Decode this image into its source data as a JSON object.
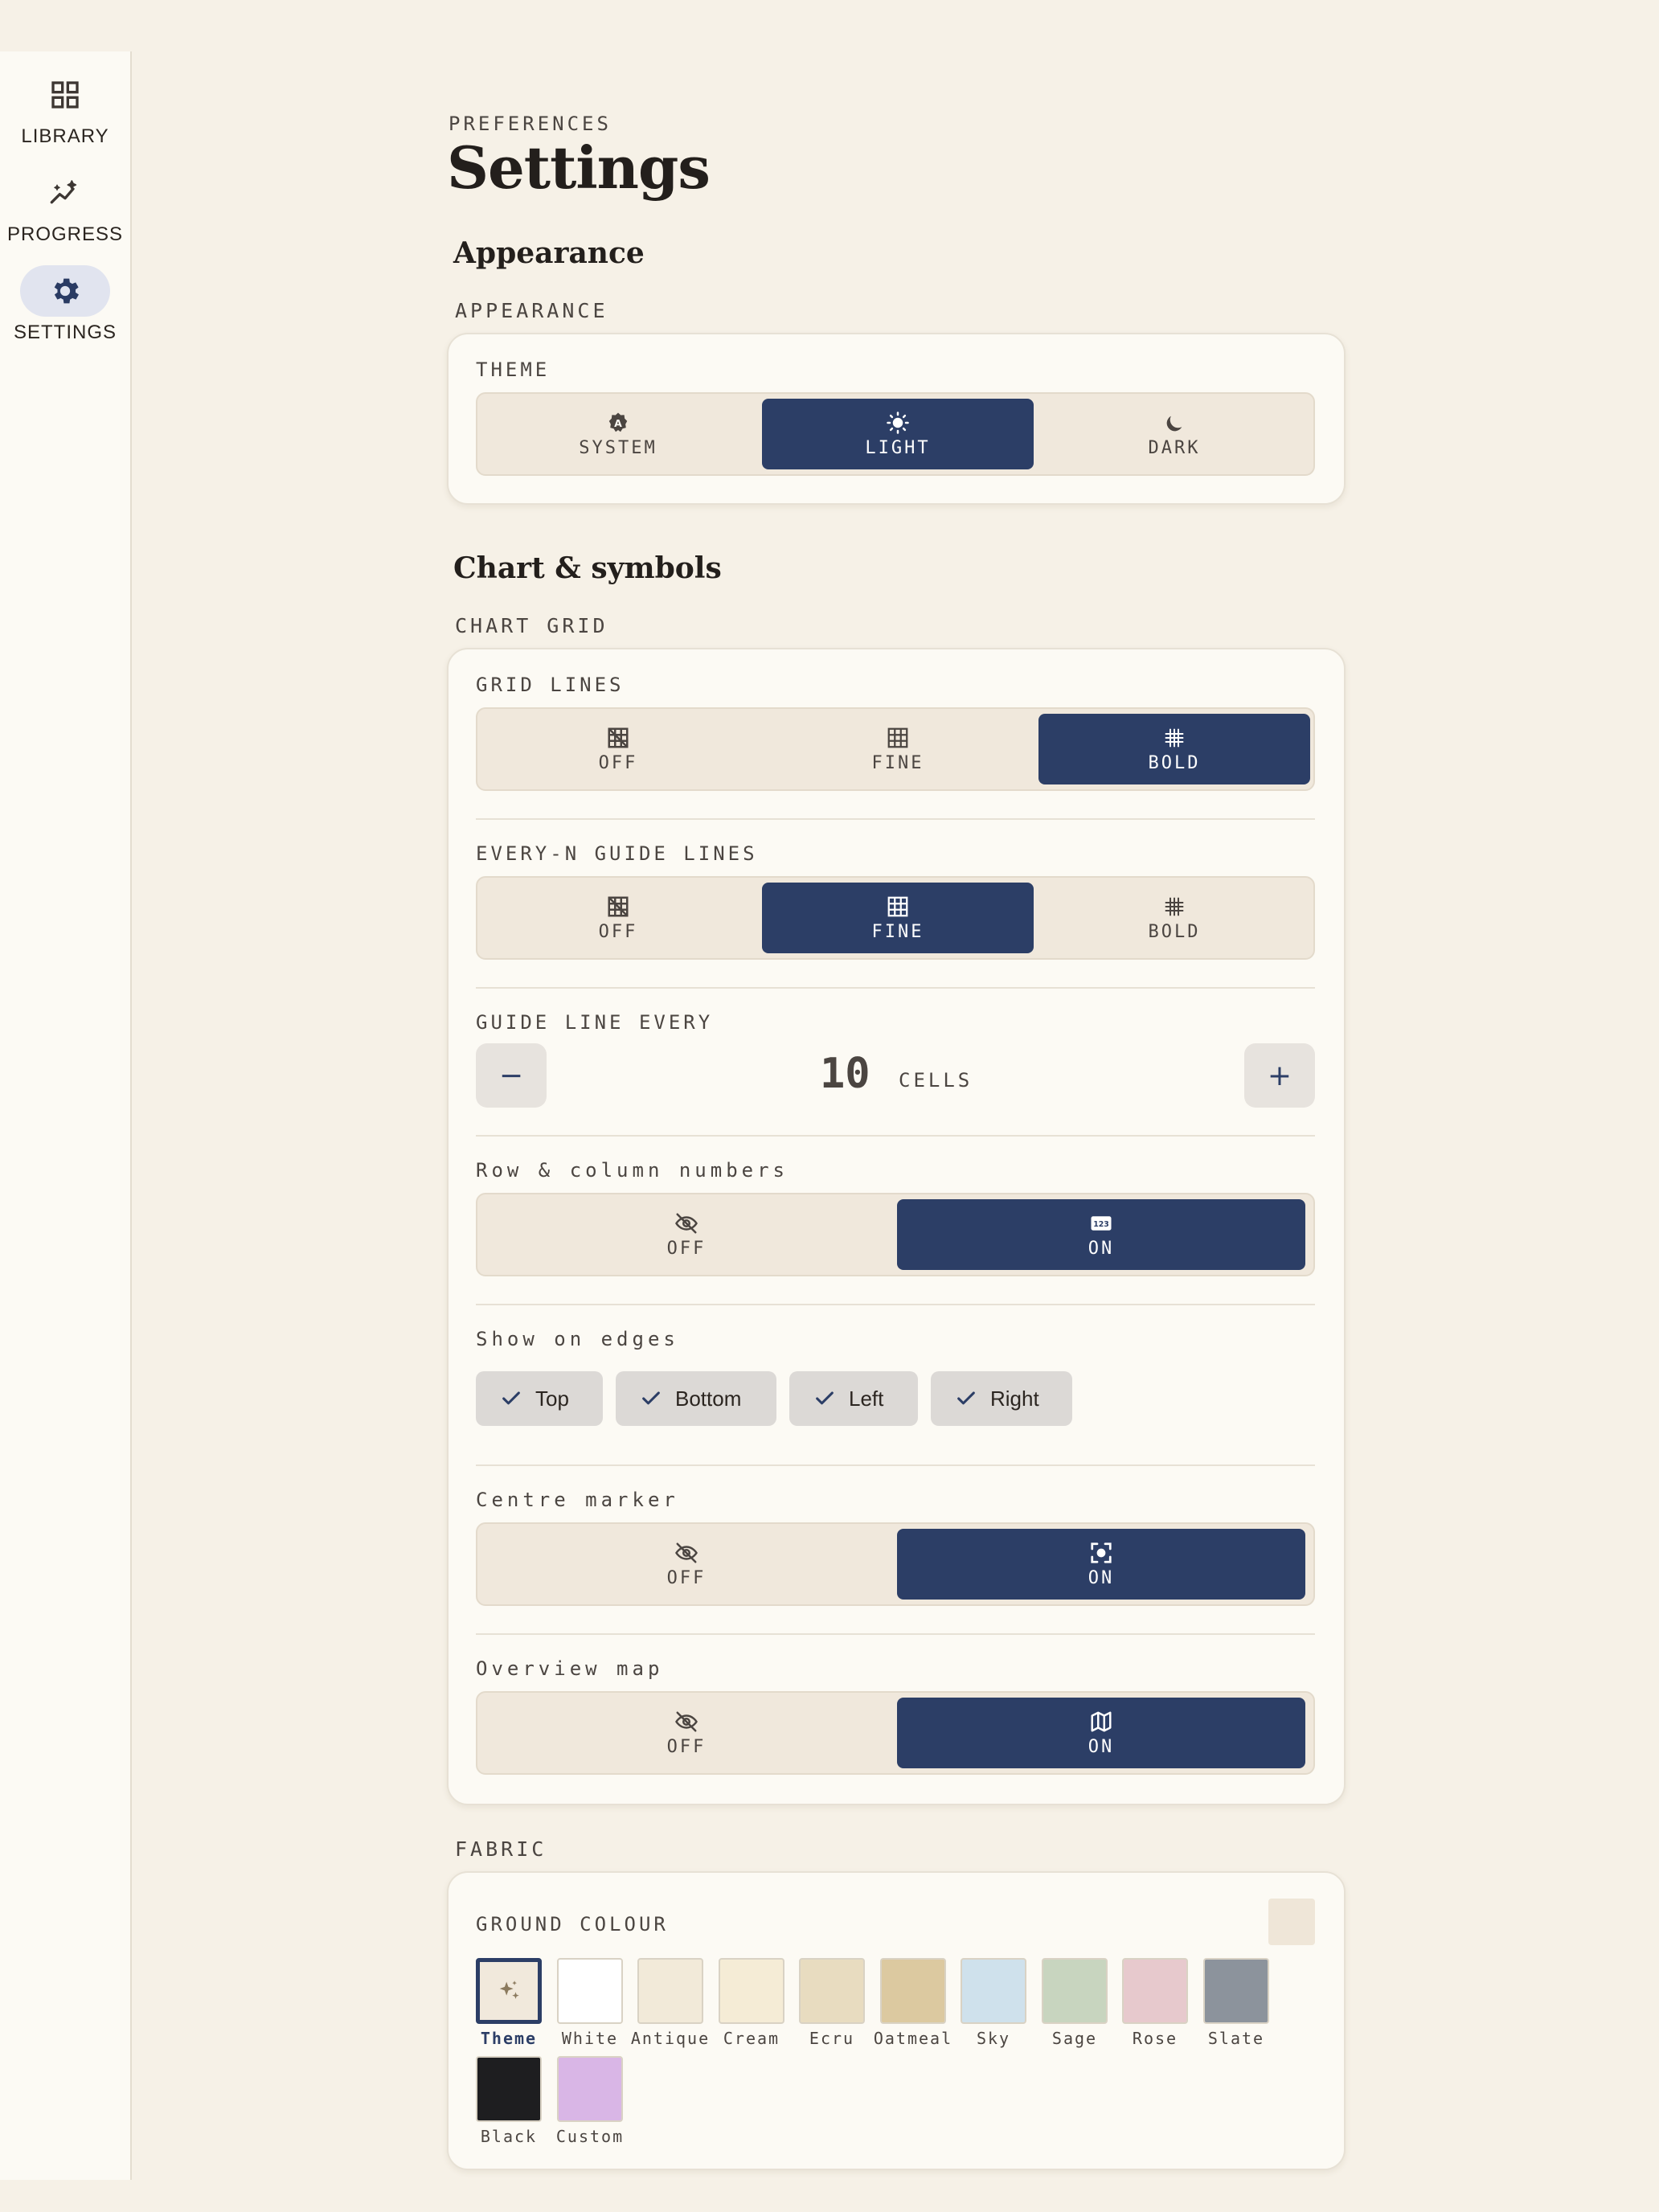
{
  "nav": [
    {
      "label": "LIBRARY",
      "icon": "grid-icon",
      "active": false
    },
    {
      "label": "PROGRESS",
      "icon": "trend-icon",
      "active": false
    },
    {
      "label": "SETTINGS",
      "icon": "gear-icon",
      "active": true
    }
  ],
  "header": {
    "eyebrow": "PREFERENCES",
    "title": "Settings"
  },
  "appearance": {
    "section_title": "Appearance",
    "group_label": "APPEARANCE",
    "theme": {
      "label": "THEME",
      "options": [
        {
          "label": "SYSTEM",
          "icon": "auto-theme-icon"
        },
        {
          "label": "LIGHT",
          "icon": "sun-icon"
        },
        {
          "label": "DARK",
          "icon": "moon-icon"
        }
      ],
      "selected": "LIGHT"
    }
  },
  "chart": {
    "section_title": "Chart & symbols",
    "group_label": "CHART GRID",
    "grid_lines": {
      "label": "GRID LINES",
      "options": [
        {
          "label": "OFF",
          "icon": "grid-off-icon"
        },
        {
          "label": "FINE",
          "icon": "grid-fine-icon"
        },
        {
          "label": "BOLD",
          "icon": "grid-bold-icon"
        }
      ],
      "selected": "BOLD"
    },
    "guide_lines": {
      "label": "EVERY-N GUIDE LINES",
      "options": [
        {
          "label": "OFF",
          "icon": "grid-off-icon"
        },
        {
          "label": "FINE",
          "icon": "grid-fine-icon"
        },
        {
          "label": "BOLD",
          "icon": "grid-bold-icon"
        }
      ],
      "selected": "FINE"
    },
    "guide_every": {
      "label": "GUIDE LINE EVERY",
      "value": "10",
      "unit": "CELLS",
      "minus": "−",
      "plus": "+"
    },
    "row_col_numbers": {
      "label": "Row & column numbers",
      "options": [
        {
          "label": "OFF",
          "icon": "eye-off-icon"
        },
        {
          "label": "ON",
          "icon": "numbers-icon"
        }
      ],
      "selected": "ON"
    },
    "edges": {
      "label": "Show on edges",
      "items": [
        {
          "label": "Top",
          "checked": true
        },
        {
          "label": "Bottom",
          "checked": true
        },
        {
          "label": "Left",
          "checked": true
        },
        {
          "label": "Right",
          "checked": true
        }
      ]
    },
    "centre_marker": {
      "label": "Centre marker",
      "options": [
        {
          "label": "OFF",
          "icon": "eye-off-icon"
        },
        {
          "label": "ON",
          "icon": "center-focus-icon"
        }
      ],
      "selected": "ON"
    },
    "overview_map": {
      "label": "Overview map",
      "options": [
        {
          "label": "OFF",
          "icon": "eye-off-icon"
        },
        {
          "label": "ON",
          "icon": "map-icon"
        }
      ],
      "selected": "ON"
    }
  },
  "fabric": {
    "group_label": "FABRIC",
    "ground": {
      "label": "GROUND COLOUR",
      "preview_color": "#efe6d8",
      "selected": "Theme",
      "swatches": [
        {
          "name": "Theme",
          "color": "#f1e9dc",
          "icon": "sparkle-icon"
        },
        {
          "name": "White",
          "color": "#ffffff"
        },
        {
          "name": "Antique",
          "color": "#f2ead9"
        },
        {
          "name": "Cream",
          "color": "#f5ecd6"
        },
        {
          "name": "Ecru",
          "color": "#e8dcc0"
        },
        {
          "name": "Oatmeal",
          "color": "#dcc9a0"
        },
        {
          "name": "Sky",
          "color": "#cfe1ec"
        },
        {
          "name": "Sage",
          "color": "#c8d5bf"
        },
        {
          "name": "Rose",
          "color": "#e7c9cd"
        },
        {
          "name": "Slate",
          "color": "#8c939c"
        },
        {
          "name": "Black",
          "color": "#1e1e20"
        },
        {
          "name": "Custom",
          "color": "#d9b6e6"
        }
      ]
    }
  },
  "colors": {
    "accent": "#2c3e66",
    "background": "#f6f1e7",
    "card": "#fcfaf4",
    "segment": "#f0e8dc"
  }
}
